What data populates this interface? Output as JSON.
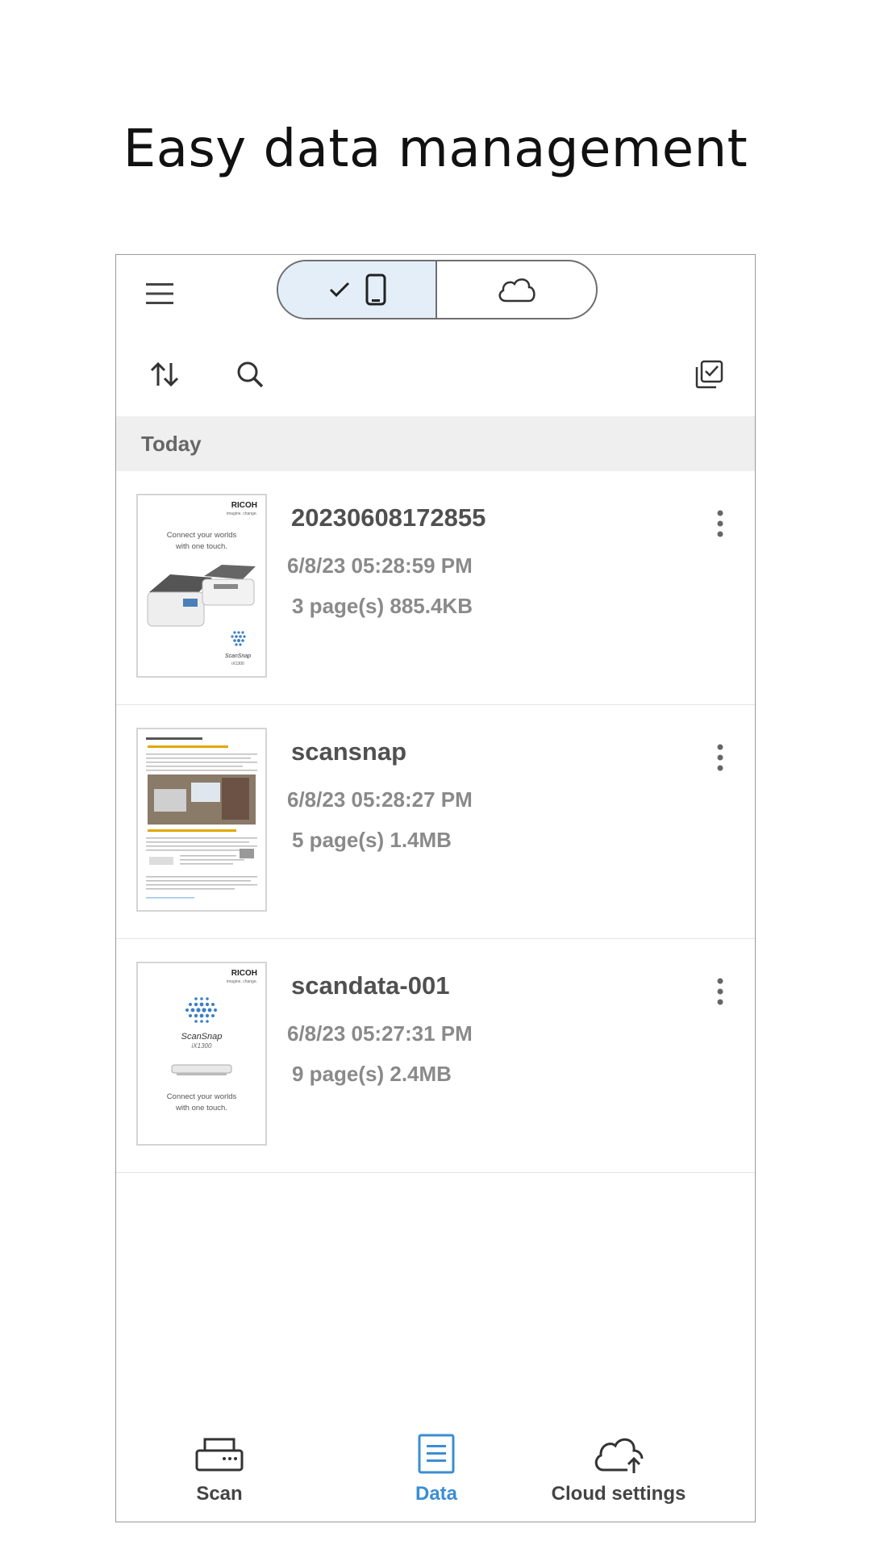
{
  "headline": "Easy data management",
  "header": {
    "menu_icon": "hamburger-menu-icon",
    "segment": {
      "left_icons": [
        "checkmark-icon",
        "smartphone-icon"
      ],
      "right_icon": "cloud-icon",
      "selected": "device"
    }
  },
  "toolbar": {
    "sort_icon": "sort-arrows-icon",
    "search_icon": "search-icon",
    "select_icon": "multi-select-icon"
  },
  "section": {
    "title": "Today"
  },
  "files": [
    {
      "name": "20230608172855",
      "date": "6/8/23 05:28:59 PM",
      "size": "3 page(s) 885.4KB"
    },
    {
      "name": "scansnap",
      "date": "6/8/23 05:28:27 PM",
      "size": "5 page(s) 1.4MB"
    },
    {
      "name": "scandata-001",
      "date": "6/8/23 05:27:31 PM",
      "size": "9 page(s) 2.4MB"
    }
  ],
  "thumbs": {
    "brand": "RICOH",
    "tagline": "imagine. change.",
    "line1": "Connect your worlds",
    "line2": "with one touch.",
    "product": "ScanSnap",
    "model": "iX1300"
  },
  "tabs": [
    {
      "label": "Scan",
      "icon": "scanner-icon"
    },
    {
      "label": "Data",
      "icon": "document-list-icon"
    },
    {
      "label": "Cloud settings",
      "icon": "cloud-upload-icon"
    }
  ],
  "colors": {
    "accent": "#3b8ed2",
    "segment_selected": "#e4eef9"
  }
}
